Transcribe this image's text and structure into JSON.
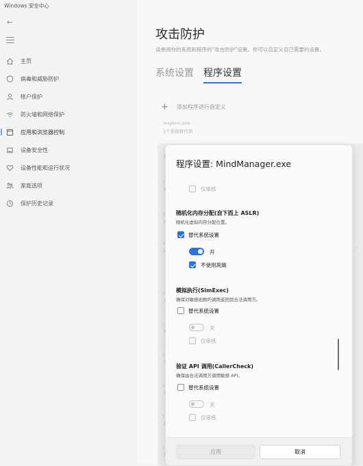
{
  "app": {
    "title": "Windows 安全中心"
  },
  "nav": {
    "items": [
      {
        "label": "主页",
        "icon": "home-icon",
        "active": false
      },
      {
        "label": "病毒和威胁防护",
        "icon": "shield-icon",
        "active": false
      },
      {
        "label": "帐户保护",
        "icon": "person-icon",
        "active": false
      },
      {
        "label": "防火墙和网络保护",
        "icon": "wifi-icon",
        "active": false
      },
      {
        "label": "应用和浏览器控制",
        "icon": "app-browser-icon",
        "active": true
      },
      {
        "label": "设备安全性",
        "icon": "laptop-icon",
        "active": false
      },
      {
        "label": "设备性能和运行状况",
        "icon": "heart-icon",
        "active": false
      },
      {
        "label": "家庭选项",
        "icon": "family-icon",
        "active": false
      },
      {
        "label": "保护历史记录",
        "icon": "history-icon",
        "active": false
      }
    ]
  },
  "main": {
    "title": "攻击防护",
    "description": "请参阅你的系统和程序的\"攻击防护\"设置。你可以自定义自己需要的设置。",
    "tabs": [
      {
        "label": "系统设置",
        "active": false
      },
      {
        "label": "程序设置",
        "active": true
      }
    ],
    "add_label": "添加程序进行自定义",
    "bg_item_name": "iexplore.exe",
    "bg_item_sub": "1个系统替代项",
    "fragments": [
      "i",
      "1",
      "h",
      "1",
      "N",
      "1",
      "C",
      "2",
      "n",
      "1",
      "n",
      "1",
      "n",
      "1",
      "n",
      "1",
      "n",
      "1",
      "n",
      "1"
    ]
  },
  "dialog": {
    "title": "程序设置: MindManager.exe",
    "audit_label_top": "仅审核",
    "sections": [
      {
        "title": "随机化内存分配(自下而上 ASLR)",
        "desc": "随机化虚拟内存分配位置。",
        "override_label": "替代系统设置",
        "override_checked": true,
        "toggle_label": "开",
        "toggle_on": true,
        "sub_label": "不使用高熵",
        "sub_checked": true
      },
      {
        "title": "模拟执行(SimExec)",
        "desc": "确保对敏感函数的调用返回到合法调用方。",
        "override_label": "替代系统设置",
        "override_checked": false,
        "toggle_label": "关",
        "toggle_on": false,
        "sub_label": "仅审核",
        "sub_checked": false
      },
      {
        "title": "验证 API 调用(CallerCheck)",
        "desc": "确保由合法调用方调用敏感 API。",
        "override_label": "替代系统设置",
        "override_checked": false,
        "toggle_label": "关",
        "toggle_on": false,
        "sub_label": "仅审核",
        "sub_checked": false
      }
    ],
    "apply_label": "应用",
    "cancel_label": "取消"
  },
  "colors": {
    "accent": "#2f72d6",
    "background": "#f3f3f3"
  }
}
